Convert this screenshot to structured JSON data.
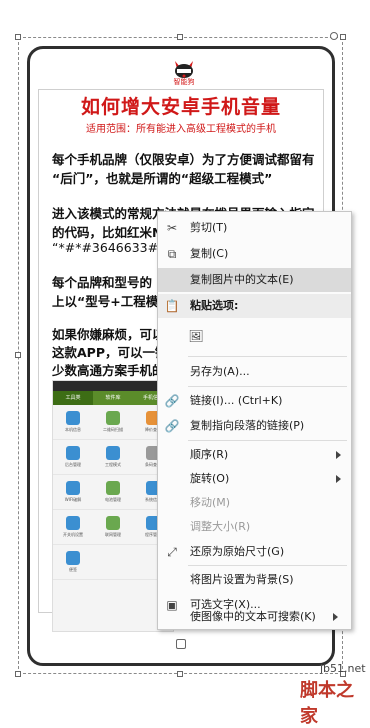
{
  "document": {
    "logo_text": "智能狗",
    "title": "如何增大安卓手机音量",
    "subtitle": "适用范围：所有能进入高级工程模式的手机",
    "para1_line1": "每个手机品牌（仅限安卓）为了方便调试都留有",
    "para1_line2": "“后门”，也就是所谓的“超级工程模式”",
    "para2_line1": "进入该模式的常规方法就是在拨号界面输入指定",
    "para2_line2": "的代码，比如红米N",
    "para2_line3": "“*#*#3646633#*",
    "para3_line1": "每个品牌和型号的",
    "para3_line2": "上以“型号+工程模",
    "para4_line1": "如果你嫌麻烦，可以",
    "para4_line2": "这款APP，可以一键",
    "para4_line3": "少数高通方案手机的"
  },
  "app_screenshot": {
    "tabs": [
      "工具类",
      "软件库",
      "手机信息"
    ],
    "icons": [
      {
        "label": "本机信息",
        "color": "#3b8fd1"
      },
      {
        "label": "二维码扫描",
        "color": "#6aa84f"
      },
      {
        "label": "降价查询",
        "color": "#e69138"
      },
      {
        "label": "后台管理",
        "color": "#3b8fd1"
      },
      {
        "label": "工程模式",
        "color": "#3b8fd1"
      },
      {
        "label": "条码查询",
        "color": "#999999"
      },
      {
        "label": "WIFI破解",
        "color": "#3b8fd1"
      },
      {
        "label": "电池管理",
        "color": "#6aa84f"
      },
      {
        "label": "系统信息",
        "color": "#3b8fd1"
      },
      {
        "label": "开关机设置",
        "color": "#3b8fd1"
      },
      {
        "label": "联网管理",
        "color": "#6aa84f"
      },
      {
        "label": "程序管理",
        "color": "#3b8fd1"
      },
      {
        "label": "便签",
        "color": "#3b8fd1"
      }
    ]
  },
  "context_menu": {
    "items": [
      {
        "label": "剪切(T)",
        "icon": "scissors-icon",
        "glyph": "✂",
        "state": "normal"
      },
      {
        "label": "复制(C)",
        "icon": "copy-icon",
        "glyph": "⧉",
        "state": "normal"
      },
      {
        "label": "复制图片中的文本(E)",
        "icon": "",
        "glyph": "",
        "state": "highlighted"
      },
      {
        "label": "粘贴选项:",
        "icon": "paste-icon",
        "glyph": "📋",
        "state": "section"
      },
      {
        "label": "",
        "icon": "paste-picture-icon",
        "glyph": "🖼",
        "state": "paste-option"
      },
      {
        "label": "另存为(A)...",
        "icon": "",
        "glyph": "",
        "state": "normal"
      },
      {
        "label": "链接(I)...  (Ctrl+K)",
        "icon": "link-icon",
        "glyph": "🔗",
        "state": "normal"
      },
      {
        "label": "复制指向段落的链接(P)",
        "icon": "paragraph-link-icon",
        "glyph": "🔗",
        "state": "normal"
      },
      {
        "label": "顺序(R)",
        "icon": "",
        "glyph": "",
        "state": "submenu"
      },
      {
        "label": "旋转(O)",
        "icon": "",
        "glyph": "",
        "state": "submenu"
      },
      {
        "label": "移动(M)",
        "icon": "",
        "glyph": "",
        "state": "disabled"
      },
      {
        "label": "调整大小(R)",
        "icon": "",
        "glyph": "",
        "state": "disabled"
      },
      {
        "label": "还原为原始尺寸(G)",
        "icon": "restore-size-icon",
        "glyph": "⤢",
        "state": "normal"
      },
      {
        "label": "将图片设置为背景(S)",
        "icon": "",
        "glyph": "",
        "state": "normal"
      },
      {
        "label": "可选文字(X)...",
        "icon": "alt-text-icon",
        "glyph": "▣",
        "state": "normal"
      },
      {
        "label": "使图像中的文本可搜索(K)",
        "icon": "",
        "glyph": "",
        "state": "submenu"
      }
    ]
  },
  "watermark": {
    "domain": "jb51.net",
    "brand": "脚本之家"
  }
}
